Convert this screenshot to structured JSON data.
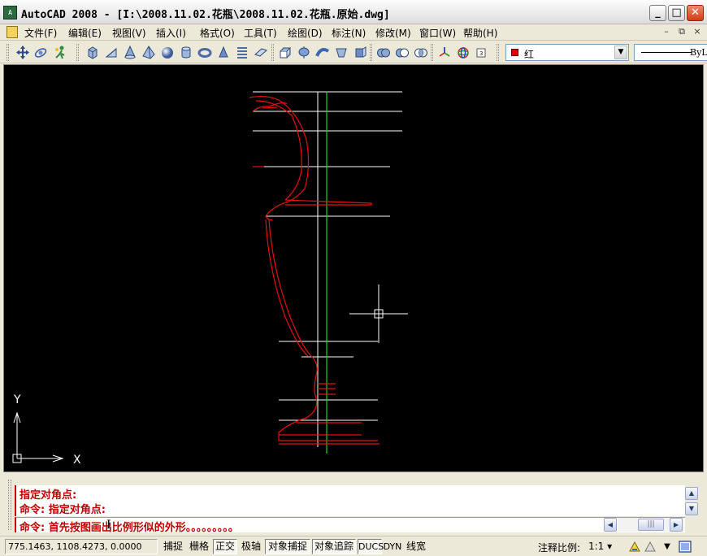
{
  "window": {
    "title": "AutoCAD 2008 - [I:\\2008.11.02.花瓶\\2008.11.02.花瓶.原始.dwg]",
    "app_icon_text": "A",
    "minimize_glyph": "_",
    "maximize_glyph": "□",
    "close_glyph": "✕"
  },
  "menu": {
    "items": [
      "文件(F)",
      "编辑(E)",
      "视图(V)",
      "插入(I)",
      "格式(O)",
      "工具(T)",
      "绘图(D)",
      "标注(N)",
      "修改(M)",
      "窗口(W)",
      "帮助(H)"
    ],
    "doc_minimize": "–",
    "doc_restore": "⧉",
    "doc_close": "×"
  },
  "toolbar": {
    "layer": {
      "name": "红",
      "color": "#e00000"
    },
    "linetype": "ByL"
  },
  "icons": {
    "toolbar": [
      "pan-icon",
      "orbit-icon",
      "walk-icon",
      "box-icon",
      "wedge-icon",
      "cone-icon",
      "pyramid-icon",
      "sphere-icon",
      "cylinder-icon",
      "torus-icon",
      "cone2-icon",
      "helix-icon",
      "planar-surface-icon",
      "extrude-icon",
      "revolve-icon",
      "sweep-icon",
      "loft-icon",
      "presspull-icon",
      "union-icon",
      "subtract-icon",
      "intersect-icon",
      "3d-move-icon",
      "3d-rotate-icon",
      "3d-align-icon"
    ]
  },
  "drawing": {
    "ucs_y_label": "Y",
    "ucs_x_label": "X",
    "colors": {
      "background": "#000000",
      "outline": "#e81010",
      "construction": "#ffffff",
      "centerline": "#00e000"
    }
  },
  "command": {
    "history": [
      "指定对角点:",
      "命令: 指定对角点:"
    ],
    "current": "命令: 首先按图画出比例形似的外形。。。。。。。。。"
  },
  "status": {
    "coords": "775.1463, 1108.4273, 0.0000",
    "buttons": [
      {
        "label": "捕捉",
        "on": false
      },
      {
        "label": "栅格",
        "on": false
      },
      {
        "label": "正交",
        "on": true
      },
      {
        "label": "极轴",
        "on": false
      },
      {
        "label": "对象捕捉",
        "on": true
      },
      {
        "label": "对象追踪",
        "on": true
      },
      {
        "label": "DUCS",
        "on": true
      },
      {
        "label": "DYN",
        "on": false
      },
      {
        "label": "线宽",
        "on": false
      }
    ],
    "annotation_scale_label": "注释比例:",
    "annotation_scale_value": "1:1 ▾"
  }
}
